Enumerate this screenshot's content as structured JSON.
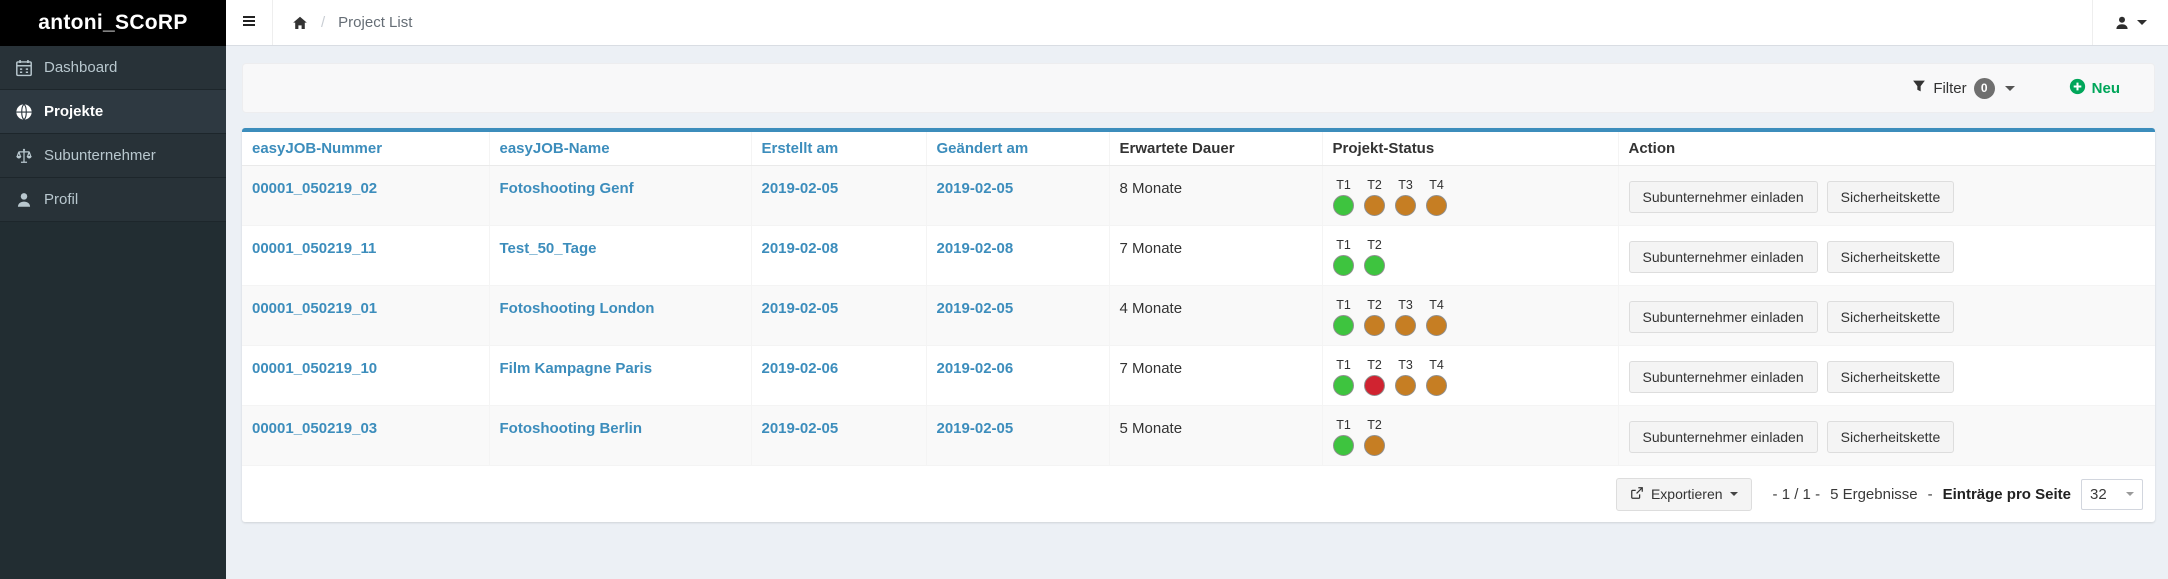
{
  "brand": {
    "name": "antoni_SCoRP"
  },
  "navbar": {
    "separator": "/",
    "breadcrumb": "Project List"
  },
  "sidebar": {
    "items": [
      {
        "label": "Dashboard",
        "icon": "calendar-icon",
        "active": false
      },
      {
        "label": "Projekte",
        "icon": "globe-icon",
        "active": true
      },
      {
        "label": "Subunternehmer",
        "icon": "balance-scale-icon",
        "active": false
      },
      {
        "label": "Profil",
        "icon": "user-icon",
        "active": false
      }
    ]
  },
  "filterbar": {
    "filter_label": "Filter",
    "filter_count": "0",
    "new_label": "Neu"
  },
  "table": {
    "columns": [
      {
        "label": "easyJOB-Nummer",
        "link": true
      },
      {
        "label": "easyJOB-Name",
        "link": true
      },
      {
        "label": "Erstellt am",
        "link": true
      },
      {
        "label": "Geändert am",
        "link": true
      },
      {
        "label": "Erwartete Dauer",
        "link": false
      },
      {
        "label": "Projekt-Status",
        "link": false
      },
      {
        "label": "Action",
        "link": false
      }
    ],
    "action_buttons": [
      {
        "label": "Subunternehmer einladen",
        "name": "invite-subcontractor-button"
      },
      {
        "label": "Sicherheitskette",
        "name": "security-chain-button"
      }
    ],
    "rows": [
      {
        "number": "00001_050219_02",
        "name": "Fotoshooting Genf",
        "created": "2019-02-05",
        "modified": "2019-02-05",
        "duration": "8 Monate",
        "statuses": [
          {
            "label": "T1",
            "color": "green"
          },
          {
            "label": "T2",
            "color": "orange"
          },
          {
            "label": "T3",
            "color": "orange"
          },
          {
            "label": "T4",
            "color": "orange"
          }
        ]
      },
      {
        "number": "00001_050219_11",
        "name": "Test_50_Tage",
        "created": "2019-02-08",
        "modified": "2019-02-08",
        "duration": "7 Monate",
        "statuses": [
          {
            "label": "T1",
            "color": "green"
          },
          {
            "label": "T2",
            "color": "green"
          }
        ]
      },
      {
        "number": "00001_050219_01",
        "name": "Fotoshooting London",
        "created": "2019-02-05",
        "modified": "2019-02-05",
        "duration": "4 Monate",
        "statuses": [
          {
            "label": "T1",
            "color": "green"
          },
          {
            "label": "T2",
            "color": "orange"
          },
          {
            "label": "T3",
            "color": "orange"
          },
          {
            "label": "T4",
            "color": "orange"
          }
        ]
      },
      {
        "number": "00001_050219_10",
        "name": "Film Kampagne Paris",
        "created": "2019-02-06",
        "modified": "2019-02-06",
        "duration": "7 Monate",
        "statuses": [
          {
            "label": "T1",
            "color": "green"
          },
          {
            "label": "T2",
            "color": "red"
          },
          {
            "label": "T3",
            "color": "orange"
          },
          {
            "label": "T4",
            "color": "orange"
          }
        ]
      },
      {
        "number": "00001_050219_03",
        "name": "Fotoshooting Berlin",
        "created": "2019-02-05",
        "modified": "2019-02-05",
        "duration": "5 Monate",
        "statuses": [
          {
            "label": "T1",
            "color": "green"
          },
          {
            "label": "T2",
            "color": "orange"
          }
        ]
      }
    ]
  },
  "footer": {
    "export_label": "Exportieren",
    "page_info": "- 1 / 1 -",
    "results": "5 Ergebnisse",
    "sep2": "-",
    "per_page_label": "Einträge pro Seite",
    "per_page_value": "32"
  },
  "colors": {
    "accent_blue": "#3c8dbc",
    "action_green": "#00a65a",
    "status": {
      "green": "#3ec43f",
      "orange": "#c67e23",
      "red": "#d02330"
    }
  }
}
